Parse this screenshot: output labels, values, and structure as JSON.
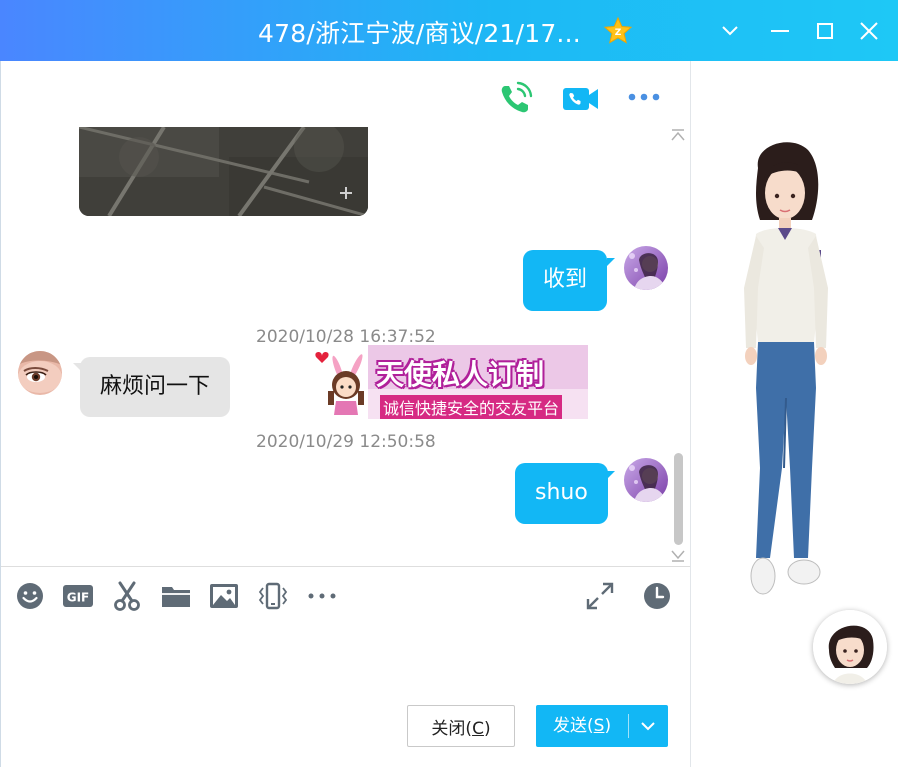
{
  "window": {
    "title": "478/浙江宁波/商议/21/17...",
    "badge_icon": "yellow-star-vip-icon",
    "controls": [
      "chevron-down-icon",
      "minimize-icon",
      "maximize-icon",
      "close-icon"
    ]
  },
  "chat_header": {
    "actions": [
      "phone-call-icon",
      "video-call-icon",
      "more-icon"
    ]
  },
  "messages": [
    {
      "type": "image",
      "direction": "in",
      "content": "photo"
    },
    {
      "type": "text",
      "direction": "out",
      "text": "收到"
    },
    {
      "type": "timestamp",
      "text": "2020/10/28 16:37:52"
    },
    {
      "type": "text",
      "direction": "in",
      "text": "麻烦问一下"
    },
    {
      "type": "sticker",
      "line1": "天使私人订制",
      "line2": "诚信快捷安全的交友平台"
    },
    {
      "type": "timestamp",
      "text": "2020/10/29 12:50:58"
    },
    {
      "type": "text",
      "direction": "out",
      "text": "shuo"
    }
  ],
  "toolbar": {
    "tools": [
      "emoji-icon",
      "gif-icon",
      "scissors-icon",
      "folder-icon",
      "image-icon",
      "shake-icon",
      "more-icon"
    ],
    "right_tools": [
      "expand-icon",
      "history-clock-icon"
    ],
    "gif_label": "GIF"
  },
  "buttons": {
    "close_label_main": "关闭(",
    "close_label_key": "C",
    "close_label_end": ")",
    "send_label_main": "发送(",
    "send_label_key": "S",
    "send_label_end": ")"
  },
  "colors": {
    "accent": "#12b7f5",
    "title_gradient_start": "#4a86ff",
    "title_gradient_end": "#1ec8f6",
    "phone_green": "#2cc673",
    "incoming_bubble": "#e5e5e5"
  }
}
